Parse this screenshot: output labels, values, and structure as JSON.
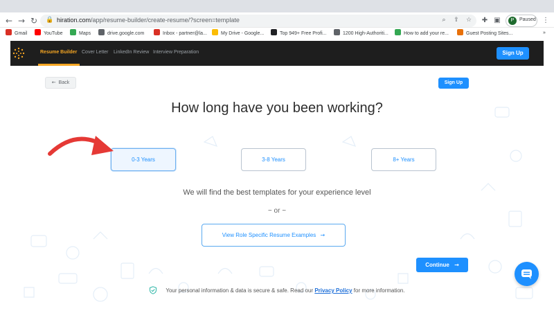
{
  "browser": {
    "url_host": "hiration.com",
    "url_path": "/app/resume-builder/create-resume/?screen=template",
    "profile_initial": "P",
    "profile_status": "Paused",
    "bookmarks": [
      {
        "label": "Gmail",
        "icon": "gmail-icon",
        "color": "#d93025"
      },
      {
        "label": "YouTube",
        "icon": "youtube-icon",
        "color": "#ff0000"
      },
      {
        "label": "Maps",
        "icon": "maps-icon",
        "color": "#34a853"
      },
      {
        "label": "drive.google.com",
        "icon": "globe-icon",
        "color": "#5f6368"
      },
      {
        "label": "Inbox - partner@la...",
        "icon": "gmail-icon",
        "color": "#d93025"
      },
      {
        "label": "My Drive - Google...",
        "icon": "drive-icon",
        "color": "#fbbc04"
      },
      {
        "label": "Top 949+ Free Profi...",
        "icon": "bookmark-icon",
        "color": "#202124"
      },
      {
        "label": "1200 High-Authoriti...",
        "icon": "globe-icon",
        "color": "#5f6368"
      },
      {
        "label": "How to add your re...",
        "icon": "bolt-icon",
        "color": "#34a853"
      },
      {
        "label": "Guest Posting Sites...",
        "icon": "chevron-icon",
        "color": "#e8710a"
      }
    ],
    "more_bookmarks": "»"
  },
  "app_nav": {
    "items": [
      "Resume Builder",
      "Cover Letter",
      "LinkedIn Review",
      "Interview Preparation"
    ],
    "signup_label": "Sign Up"
  },
  "page": {
    "back_label": "Back",
    "signup_label": "Sign Up",
    "question": "How long have you been working?",
    "options": [
      "0-3 Years",
      "3-8 Years",
      "8+ Years"
    ],
    "selected_option": "0-3 Years",
    "hint": "We will find the best templates for your experience level",
    "or_separator": "~ or ~",
    "role_button": "View Role Specific Resume Examples",
    "continue_label": "Continue",
    "privacy_before": "Your personal information & data is secure & safe. Read our ",
    "privacy_link": "Privacy Policy",
    "privacy_after": " for more information."
  },
  "colors": {
    "accent": "#1e90ff",
    "nav_bg": "#1e1e1e",
    "active_nav": "#f5a623",
    "annotation_arrow": "#e53935"
  }
}
